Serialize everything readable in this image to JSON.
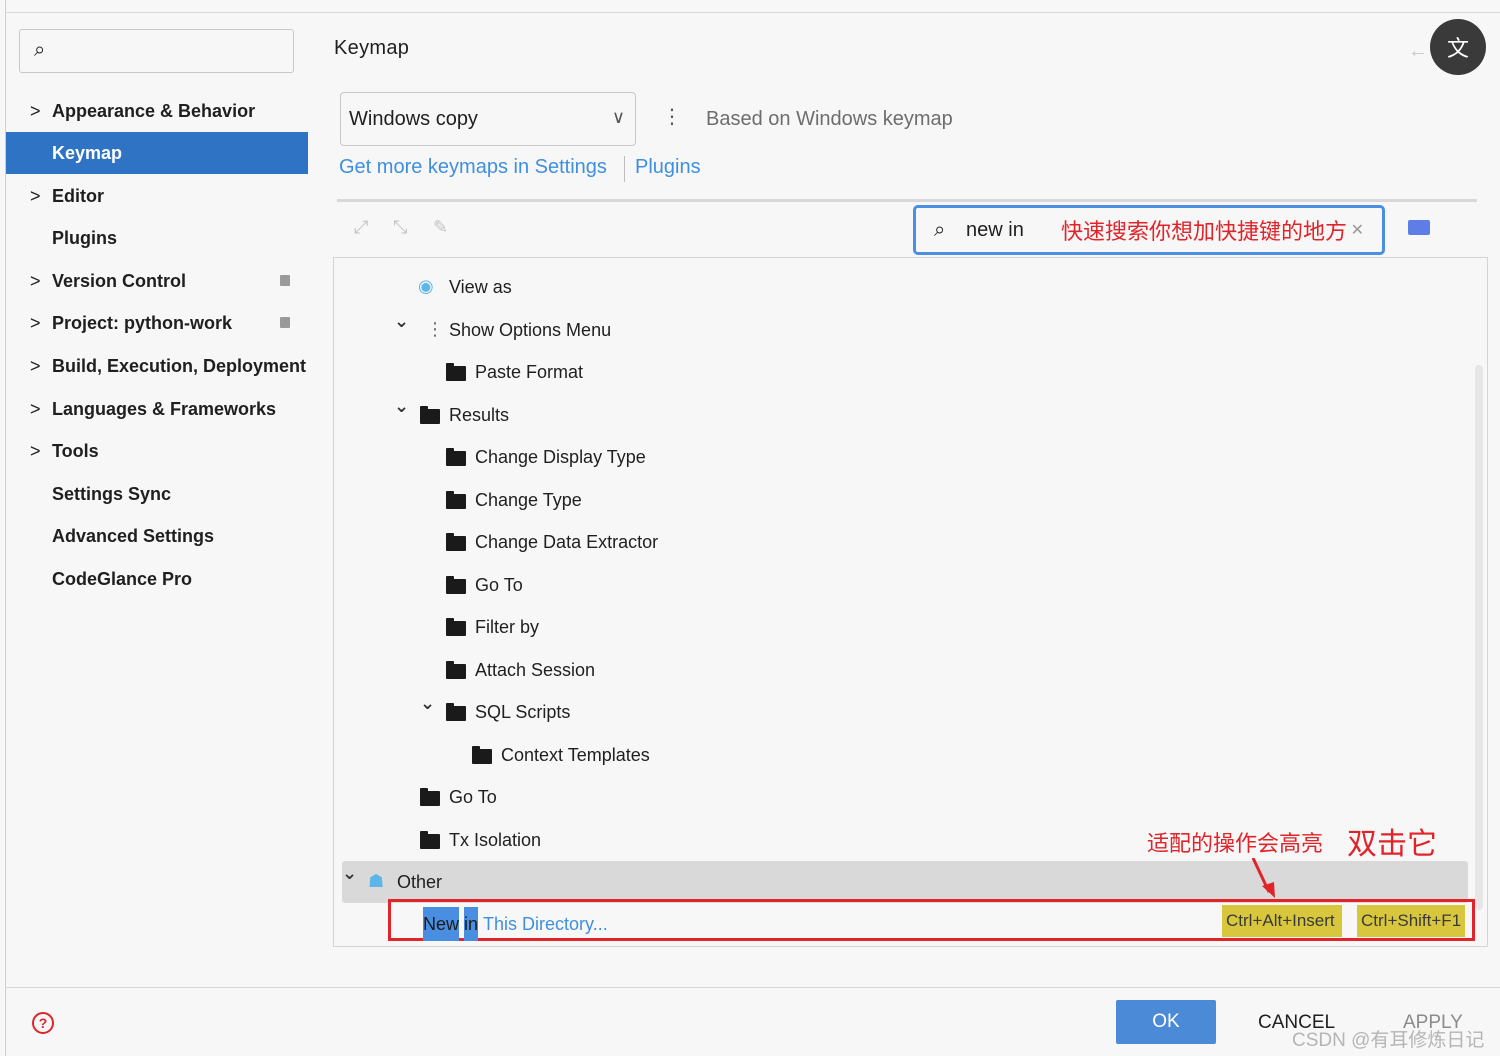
{
  "sidebar": {
    "search_placeholder": "",
    "items": [
      {
        "label": "Appearance & Behavior",
        "chevron": ">",
        "badge": false,
        "selected": false
      },
      {
        "label": "Keymap",
        "chevron": "",
        "badge": false,
        "selected": true
      },
      {
        "label": "Editor",
        "chevron": ">",
        "badge": false,
        "selected": false
      },
      {
        "label": "Plugins",
        "chevron": "",
        "badge": false,
        "selected": false
      },
      {
        "label": "Version Control",
        "chevron": ">",
        "badge": true,
        "selected": false
      },
      {
        "label": "Project: python-work",
        "chevron": ">",
        "badge": true,
        "selected": false
      },
      {
        "label": "Build, Execution, Deployment",
        "chevron": ">",
        "badge": false,
        "selected": false
      },
      {
        "label": "Languages & Frameworks",
        "chevron": ">",
        "badge": false,
        "selected": false
      },
      {
        "label": "Tools",
        "chevron": ">",
        "badge": false,
        "selected": false
      },
      {
        "label": "Settings Sync",
        "chevron": "",
        "badge": false,
        "selected": false
      },
      {
        "label": "Advanced Settings",
        "chevron": "",
        "badge": false,
        "selected": false
      },
      {
        "label": "CodeGlance Pro",
        "chevron": "",
        "badge": false,
        "selected": false
      }
    ]
  },
  "main": {
    "title": "Keymap",
    "keymap_select": "Windows copy",
    "based_on": "Based on Windows keymap",
    "link_settings": "Get more keymaps in Settings",
    "link_plugins": "Plugins",
    "filter_value": "new in",
    "tree": [
      {
        "label": "View as",
        "icon": "eye-icon",
        "toggle": ""
      },
      {
        "label": "Show Options Menu",
        "icon": "kebab-icon",
        "toggle": "v"
      },
      {
        "label": "Paste Format",
        "icon": "folder-icon",
        "toggle": ""
      },
      {
        "label": "Results",
        "icon": "folder-icon",
        "toggle": "v"
      },
      {
        "label": "Change Display Type",
        "icon": "folder-icon",
        "toggle": ""
      },
      {
        "label": "Change Type",
        "icon": "folder-icon",
        "toggle": ""
      },
      {
        "label": "Change Data Extractor",
        "icon": "folder-icon",
        "toggle": ""
      },
      {
        "label": "Go To",
        "icon": "folder-icon",
        "toggle": ""
      },
      {
        "label": "Filter by",
        "icon": "folder-icon",
        "toggle": ""
      },
      {
        "label": "Attach Session",
        "icon": "folder-icon",
        "toggle": ""
      },
      {
        "label": "SQL Scripts",
        "icon": "folder-icon",
        "toggle": "v"
      },
      {
        "label": "Context Templates",
        "icon": "folder-icon",
        "toggle": ""
      },
      {
        "label": "Go To",
        "icon": "folder-icon",
        "toggle": ""
      },
      {
        "label": "Tx Isolation",
        "icon": "folder-icon",
        "toggle": ""
      },
      {
        "label": "Other",
        "icon": "basket-icon",
        "toggle": "v"
      }
    ],
    "action": {
      "word1": "New",
      "word2": "in",
      "rest": "This Directory...",
      "shortcut1": "Ctrl+Alt+Insert",
      "shortcut2": "Ctrl+Shift+F1"
    }
  },
  "annotations": {
    "search_hint": "快速搜索你想加快捷键的地方",
    "highlight_note": "适配的操作会高亮",
    "double_click": "双击它"
  },
  "footer": {
    "ok": "OK",
    "cancel": "CANCEL",
    "apply": "APPLY",
    "help": "?"
  },
  "watermark": "CSDN @有耳修炼日记",
  "colors": {
    "accent": "#2f74c4",
    "link": "#3f8fe0",
    "annotation": "#e0242a",
    "shortcut_bg": "#d8c63c",
    "highlight": "#4a8ee2"
  }
}
